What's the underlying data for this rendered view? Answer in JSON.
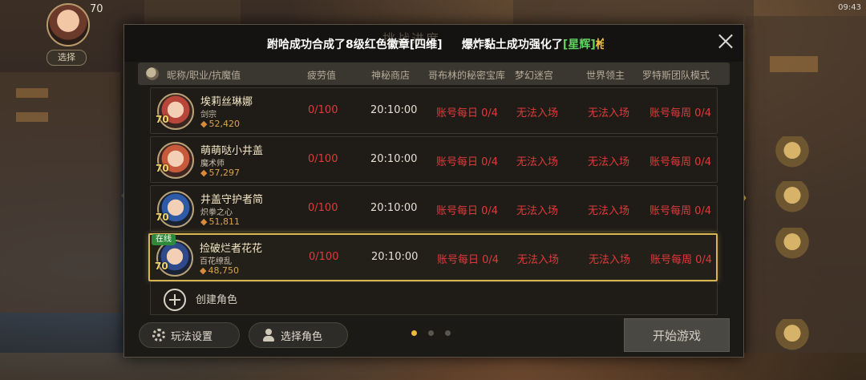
{
  "hud": {
    "level": "70",
    "player_tag": "选择",
    "status_time": "09:43"
  },
  "dialog": {
    "ghost_title": "挑战进度",
    "ticker": {
      "part1": "跗哈成功合成了8级红色徽章",
      "part1_item": "[四维]",
      "part2": "爆炸黏土成功强化了",
      "part2_item": "[星辉]",
      "part2_tail": "枪械"
    }
  },
  "table": {
    "headers": [
      "昵称/职业/抗魔值",
      "疲劳值",
      "神秘商店",
      "哥布林的秘密宝库",
      "梦幻迷宫",
      "世界领主",
      "罗特斯团队模式"
    ],
    "rows": [
      {
        "name": "埃莉丝琳娜",
        "job": "剑宗",
        "power": "52,420",
        "level": "70",
        "online": "",
        "fatigue": "0/100",
        "shop": "20:10:00",
        "goblin": "账号每日 0/4",
        "maze": "无法入场",
        "lord": "无法入场",
        "rotes": "账号每周 0/4"
      },
      {
        "name": "萌萌哒小井盖",
        "job": "魔术师",
        "power": "57,297",
        "level": "70",
        "online": "",
        "fatigue": "0/100",
        "shop": "20:10:00",
        "goblin": "账号每日 0/4",
        "maze": "无法入场",
        "lord": "无法入场",
        "rotes": "账号每周 0/4"
      },
      {
        "name": "井盖守护者简",
        "job": "炽拳之心",
        "power": "51,811",
        "level": "70",
        "online": "",
        "fatigue": "0/100",
        "shop": "20:10:00",
        "goblin": "账号每日 0/4",
        "maze": "无法入场",
        "lord": "无法入场",
        "rotes": "账号每周 0/4"
      },
      {
        "name": "捡破烂者花花",
        "job": "百花缭乱",
        "power": "48,750",
        "level": "70",
        "online": "在线",
        "fatigue": "0/100",
        "shop": "20:10:00",
        "goblin": "账号每日 0/4",
        "maze": "无法入场",
        "lord": "无法入场",
        "rotes": "账号每周 0/4"
      }
    ],
    "create_label": "创建角色"
  },
  "footer": {
    "settings_label": "玩法设置",
    "select_label": "选择角色",
    "start_label": "开始游戏",
    "page_count": 3,
    "active_page": 1
  },
  "colors": {
    "accent_gold": "#d7b450",
    "locked_red": "#e03a3a",
    "online_green": "#2d8a3a"
  }
}
